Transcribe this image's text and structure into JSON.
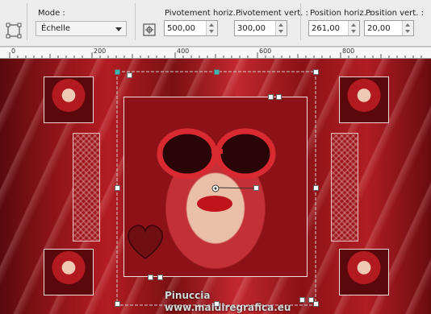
{
  "toolbar": {
    "mode_label": "Mode :",
    "mode_value": "Échelle",
    "pivot_h_label": "Pivotement horiz. :",
    "pivot_h_value": "500,00",
    "pivot_v_label": "Pivotement vert. :",
    "pivot_v_value": "300,00",
    "pos_h_label": "Position horiz. :",
    "pos_h_value": "261,00",
    "pos_v_label": "Position vert. :",
    "pos_v_value": "20,00"
  },
  "ruler": {
    "marks": [
      "0",
      "200",
      "400",
      "600",
      "800"
    ]
  },
  "canvas": {
    "watermark_name": "Pinuccia",
    "watermark_url": "www.maidiregrafica.eu"
  },
  "colors": {
    "accent_red": "#b31c22",
    "dark_red": "#5a0a0d",
    "toolbar_bg": "#ececec"
  },
  "icons": [
    "deform-tool-icon",
    "pivot-point-icon",
    "chevron-down-icon",
    "spin-up-icon",
    "spin-down-icon"
  ]
}
